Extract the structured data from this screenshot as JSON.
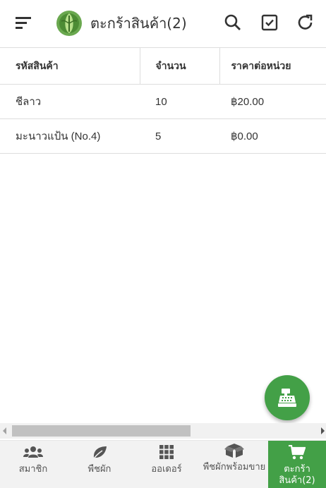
{
  "header": {
    "title": "ตะกร้าสินค้า(2)",
    "icons": [
      "menu-icon",
      "logo",
      "search-icon",
      "check-square-icon",
      "refresh-icon"
    ]
  },
  "table": {
    "columns": [
      "รหัสสินค้า",
      "จำนวน",
      "ราคาต่อหน่วย"
    ],
    "rows": [
      [
        "ชีลาว",
        "10",
        "฿20.00"
      ],
      [
        "มะนาวแป้น (No.4)",
        "5",
        "฿0.00"
      ]
    ]
  },
  "fab": {
    "icon": "cash-register-icon"
  },
  "bottom_nav": {
    "items": [
      {
        "label": "สมาชิก",
        "icon": "users-icon"
      },
      {
        "label": "พืชผัก",
        "icon": "leaf-icon"
      },
      {
        "label": "ออเดอร์",
        "icon": "grid-icon"
      },
      {
        "label": "พืชผักพร้อมขาย",
        "icon": "boxes-icon"
      },
      {
        "label": "ตะกร้าสินค้า(2)",
        "icon": "cart-icon"
      }
    ]
  },
  "colors": {
    "accent": "#43a047",
    "nav_bg": "#f2f2f2"
  }
}
